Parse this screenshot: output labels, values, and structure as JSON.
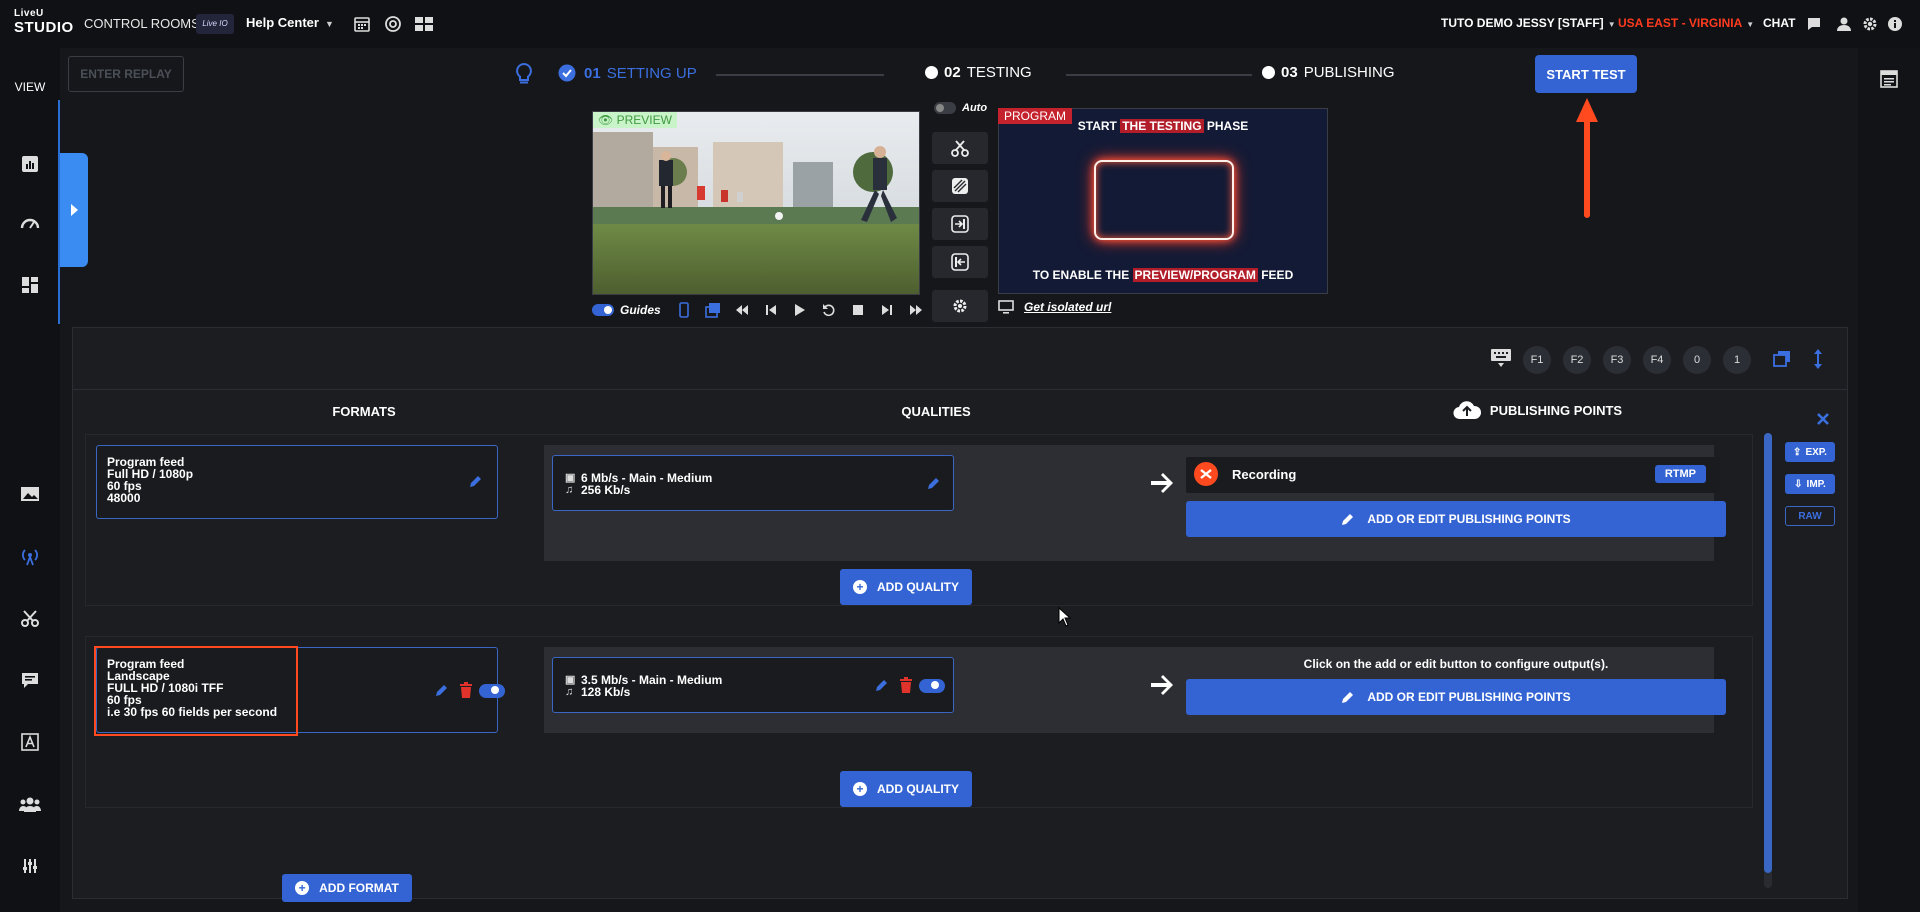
{
  "topbar": {
    "logo_top": "LiveU",
    "logo_bottom": "STUDIO",
    "control_rooms": "CONTROL ROOMS",
    "brand_chip": "Live IO",
    "help_center": "Help Center",
    "user": "TUTO DEMO JESSY [STAFF]",
    "region": "USA EAST - VIRGINIA",
    "chat": "CHAT",
    "icons": [
      "calendar-icon",
      "lifebuoy-icon",
      "layout-icon",
      "message-icon",
      "user-icon",
      "gear-icon",
      "info-icon"
    ]
  },
  "sidebar": {
    "view": "VIEW",
    "icons": [
      "chart-icon",
      "gauge-icon",
      "dashboard-icon",
      "image-icon",
      "antenna-icon",
      "scissors-icon",
      "caption-icon",
      "text-icon",
      "users-icon",
      "sliders-icon"
    ]
  },
  "steps": {
    "replay": "ENTER REPLAY",
    "s1_num": "01",
    "s1_label": "SETTING UP",
    "s2_num": "02",
    "s2_label": "TESTING",
    "s3_num": "03",
    "s3_label": "PUBLISHING",
    "start_test": "START TEST"
  },
  "monitor": {
    "preview_tag": "PREVIEW",
    "program_tag": "PROGRAM",
    "program_line1_a": "START ",
    "program_line1_b": "THE TESTING",
    "program_line1_c": " PHASE",
    "program_line2_a": "TO ENABLE THE ",
    "program_line2_b": "PREVIEW/PROGRAM",
    "program_line2_c": " FEED",
    "auto": "Auto",
    "guides": "Guides",
    "isolated_url": "Get isolated url"
  },
  "toolbar_keys": [
    "F1",
    "F2",
    "F3",
    "F4",
    "0",
    "1"
  ],
  "columns": {
    "formats": "FORMATS",
    "qualities": "QUALITIES",
    "publishing": "PUBLISHING POINTS"
  },
  "formats": [
    {
      "lines": [
        "Program feed",
        "Full HD / 1080p",
        "60 fps",
        "48000"
      ],
      "quality_video": "6 Mb/s  -  Main  -  Medium",
      "quality_audio": "256 Kb/s",
      "recording": "Recording",
      "rtmp": "RTMP",
      "pub_button": "ADD OR EDIT PUBLISHING POINTS",
      "add_quality": "ADD QUALITY"
    },
    {
      "lines": [
        "Program feed",
        "Landscape",
        "FULL HD / 1080i TFF",
        "60 fps",
        "i.e 30 fps 60 fields per second"
      ],
      "quality_video": "3.5 Mb/s  -  Main  -  Medium",
      "quality_audio": "128 Kb/s",
      "hint": "Click on the add or edit button to configure output(s).",
      "pub_button": "ADD OR EDIT PUBLISHING POINTS",
      "add_quality": "ADD QUALITY"
    }
  ],
  "add_format": "ADD FORMAT",
  "side_tools": {
    "exp": "EXP.",
    "imp": "IMP.",
    "raw": "RAW"
  },
  "colors": {
    "accent": "#3464d3",
    "alert": "#ff4a1f",
    "region": "#ff3b1f",
    "preview_green": "#3f9b3f",
    "program_red": "#c4222c"
  }
}
